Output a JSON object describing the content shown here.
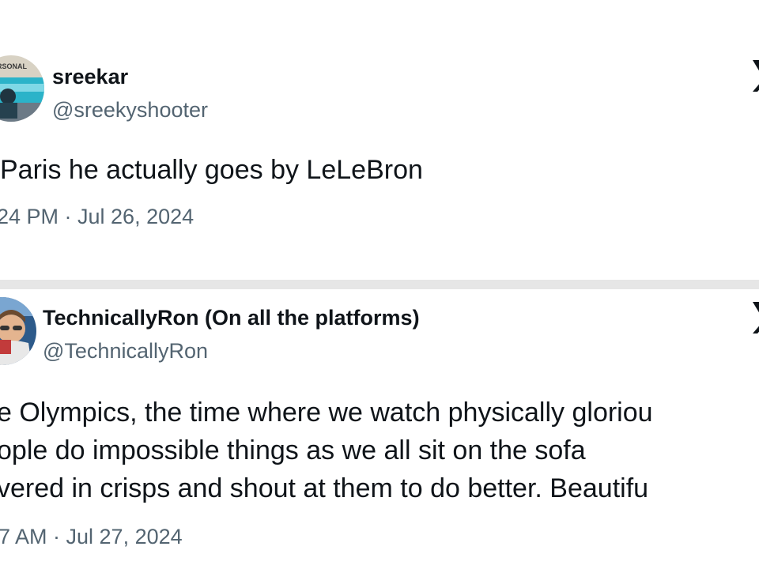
{
  "tweets": [
    {
      "display_name": "sreekar",
      "handle": "@sreekyshooter",
      "avatar_text": "RSONAL",
      "text_lines": [
        "Paris he actually goes by LeLeBron"
      ],
      "timestamp": "24 PM · Jul 26, 2024"
    },
    {
      "display_name": "TechnicallyRon (On all the platforms)",
      "handle": "@TechnicallyRon",
      "text_lines": [
        "e Olympics, the time where we watch physically gloriou",
        "ople do impossible things as we all sit on the sofa",
        "vered in crisps and shout at them to do better. Beautifu"
      ],
      "timestamp": "7 AM · Jul 27, 2024"
    }
  ],
  "icons": {
    "brand_logo": "x-logo-icon"
  },
  "colors": {
    "text_primary": "#0f1419",
    "text_secondary": "#536471",
    "divider": "#e6e6e6",
    "background": "#ffffff"
  }
}
